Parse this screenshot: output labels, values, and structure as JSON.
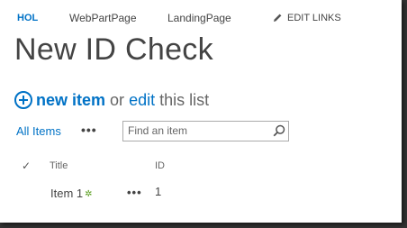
{
  "nav": {
    "items": [
      "HOL",
      "WebPartPage",
      "LandingPage"
    ],
    "edit_links": "EDIT LINKS"
  },
  "page": {
    "title": "New ID Check"
  },
  "actions": {
    "new_item": "new item",
    "or": "or",
    "edit": "edit",
    "this_list": "this list"
  },
  "views": {
    "all_items": "All Items",
    "more": "•••"
  },
  "search": {
    "placeholder": "Find an item"
  },
  "list": {
    "headers": {
      "check": "✓",
      "title": "Title",
      "id": "ID"
    },
    "rows": [
      {
        "title": "Item 1",
        "new_badge": "✲",
        "menu": "•••",
        "id": "1"
      }
    ]
  },
  "colors": {
    "accent": "#0072c6",
    "new_badge": "#5a9e20",
    "text": "#444444"
  }
}
